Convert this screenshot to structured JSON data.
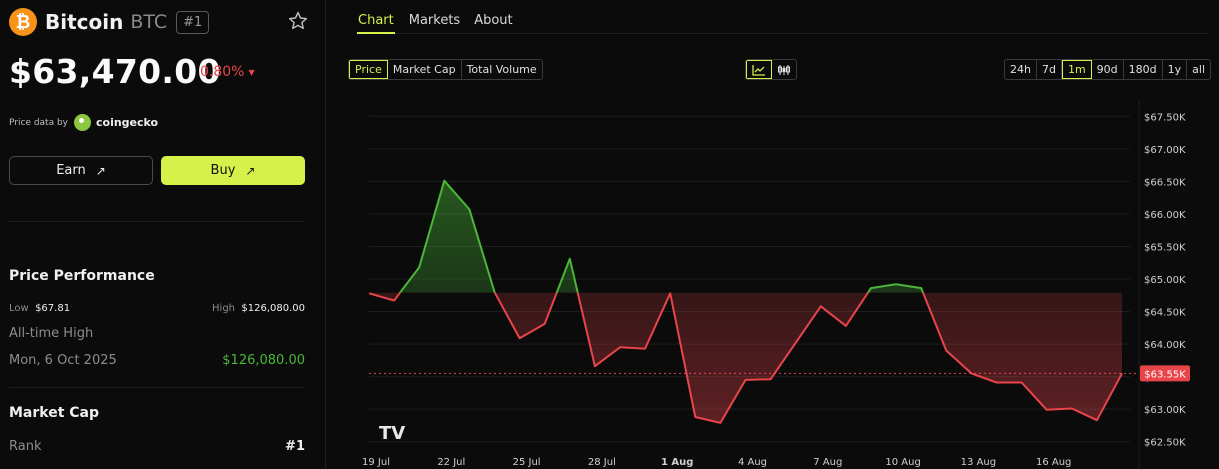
{
  "coin": {
    "name": "Bitcoin",
    "symbol": "BTC",
    "rank_badge": "#1",
    "logo_glyph": "₿",
    "brand_color": "#f7931a"
  },
  "price": "$63,470.00",
  "change": {
    "percent": "0.80%",
    "direction_glyph": "▼",
    "color": "#e8454a"
  },
  "price_data": {
    "label": "Price data by",
    "provider": "coingecko"
  },
  "actions": {
    "earn_label": "Earn",
    "buy_label": "Buy",
    "arrow_glyph": "↗",
    "accent": "#d6f24a"
  },
  "performance": {
    "title": "Price Performance",
    "low_label": "Low",
    "low_value": "$67.81",
    "high_label": "High",
    "high_value": "$126,080.00",
    "ath_label": "All-time High",
    "ath_date": "Mon, 6 Oct 2025",
    "ath_value": "$126,080.00"
  },
  "market_cap": {
    "title": "Market Cap",
    "rank_label": "Rank",
    "rank_value": "#1"
  },
  "tabs": [
    {
      "label": "Chart",
      "active": true
    },
    {
      "label": "Markets"
    },
    {
      "label": "About"
    }
  ],
  "metric_toggle": [
    "Price",
    "Market Cap",
    "Total Volume"
  ],
  "metric_selected": "Price",
  "chart_style": [
    "line-chart-icon",
    "candlestick-icon"
  ],
  "ranges": [
    "24h",
    "7d",
    "1m",
    "90d",
    "180d",
    "1y",
    "all"
  ],
  "range_selected": "1m",
  "watermark": "TV",
  "chart_data": {
    "type": "line",
    "x_labels": [
      "19 Jul",
      "22 Jul",
      "25 Jul",
      "28 Jul",
      "1 Aug",
      "4 Aug",
      "7 Aug",
      "10 Aug",
      "13 Aug",
      "16 Aug"
    ],
    "y_ticks": [
      "$67.50K",
      "$67.00K",
      "$66.50K",
      "$66.00K",
      "$65.50K",
      "$65.00K",
      "$64.50K",
      "$64.00K",
      "$63.50K",
      "$63.00K",
      "$62.50K"
    ],
    "y_tick_values": [
      67500,
      67000,
      66500,
      66000,
      65500,
      65000,
      64500,
      64000,
      63500,
      63000,
      62500
    ],
    "ylim": [
      62250,
      67750
    ],
    "baseline": 64790,
    "current_label": "$63.55K",
    "current_value": 63550,
    "x": [
      0,
      1,
      2,
      3,
      4,
      5,
      6,
      7,
      8,
      9,
      10,
      11,
      12,
      13,
      14,
      15,
      16,
      17,
      18,
      19,
      20,
      21,
      22,
      23,
      24,
      25,
      26,
      27,
      28,
      29,
      30
    ],
    "values": [
      64780,
      64670,
      65180,
      66510,
      66070,
      64800,
      64090,
      64310,
      65310,
      63660,
      63950,
      63930,
      64780,
      62880,
      62790,
      63450,
      63460,
      64020,
      64580,
      64280,
      64860,
      64920,
      64860,
      63900,
      63550,
      63410,
      63410,
      62990,
      63010,
      62830,
      63550
    ],
    "up_color": "#4ab738",
    "down_color": "#e8454a",
    "grid": true
  }
}
